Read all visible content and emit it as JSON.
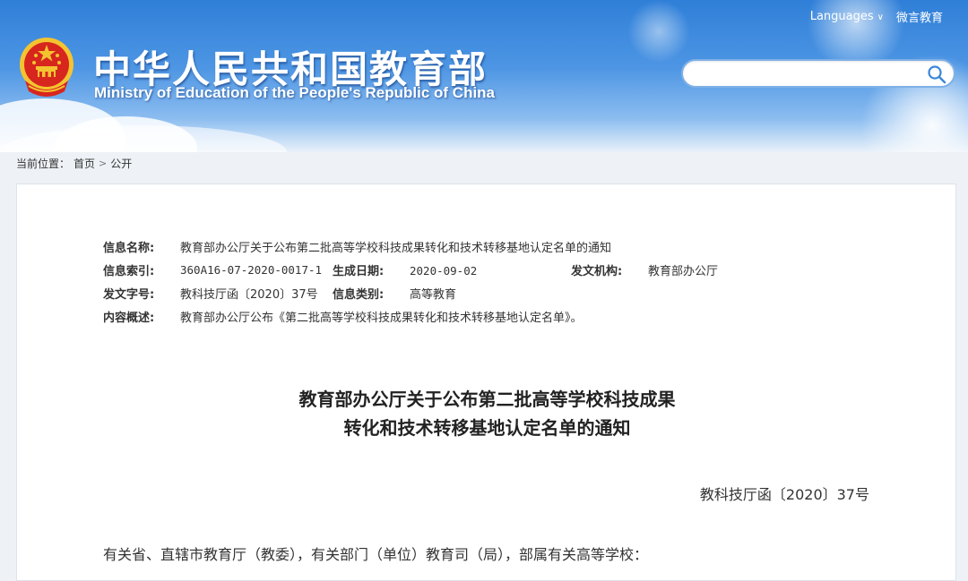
{
  "header": {
    "title": "中华人民共和国教育部",
    "subtitle": "Ministry of Education of the People's Republic of China",
    "nav": {
      "languages": "Languages",
      "weibo": "微言教育"
    },
    "search": {
      "value": "",
      "placeholder": ""
    }
  },
  "breadcrumb": {
    "prefix": "当前位置：",
    "items": [
      "首页",
      "公开"
    ]
  },
  "meta": {
    "name_label": "信息名称:",
    "name_value": "教育部办公厅关于公布第二批高等学校科技成果转化和技术转移基地认定名单的通知",
    "index_label": "信息索引:",
    "index_value": "360A16-07-2020-0017-1",
    "date_label": "生成日期:",
    "date_value": "2020-09-02",
    "org_label": "发文机构:",
    "org_value": "教育部办公厅",
    "docno_label": "发文字号:",
    "docno_value": "教科技厅函〔2020〕37号",
    "category_label": "信息类别:",
    "category_value": "高等教育",
    "summary_label": "内容概述:",
    "summary_value": "教育部办公厅公布《第二批高等学校科技成果转化和技术转移基地认定名单》。"
  },
  "document": {
    "title_line1": "教育部办公厅关于公布第二批高等学校科技成果",
    "title_line2": "转化和技术转移基地认定名单的通知",
    "number": "教科技厅函〔2020〕37号",
    "salutation": "有关省、直辖市教育厅（教委），有关部门（单位）教育司（局），部属有关高等学校："
  },
  "colors": {
    "banner_top": "#2f7fd8",
    "banner_bottom": "#e9f1f9",
    "emblem_red": "#d7261e",
    "emblem_gold": "#f4c430"
  }
}
